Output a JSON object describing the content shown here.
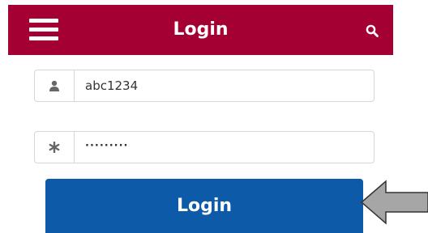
{
  "header": {
    "title": "Login",
    "background_color": "#a50034",
    "menu_icon": "hamburger-menu-icon",
    "search_icon": "search-icon"
  },
  "form": {
    "username": {
      "icon": "user-icon",
      "value": "abc1234"
    },
    "password": {
      "icon": "asterisk-icon",
      "value": "·········"
    },
    "submit_label": "Login",
    "submit_color": "#0c5aa8"
  },
  "annotation": {
    "icon": "left-arrow-pointer-icon",
    "color": "#a6a6a6"
  }
}
